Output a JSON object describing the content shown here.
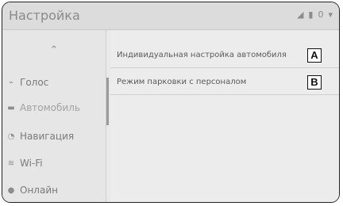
{
  "header": {
    "title": "Настройка",
    "status_icons": [
      "signal-icon",
      "battery-icon",
      "zero-icon",
      "dropdown-icon"
    ],
    "status_text": [
      "◢",
      "▮",
      "0",
      "▾"
    ]
  },
  "sidebar": {
    "up_arrow": "⌃",
    "items": [
      {
        "label": "Голос",
        "icon": "voice-icon",
        "glyph": "⌁"
      },
      {
        "label": "Автомобиль",
        "icon": "car-icon",
        "glyph": "▬"
      },
      {
        "label": "Навигация",
        "icon": "navigation-icon",
        "glyph": "◔"
      },
      {
        "label": "Wi-Fi",
        "icon": "wifi-icon",
        "glyph": "≋"
      },
      {
        "label": "Онлайн",
        "icon": "online-icon",
        "glyph": "●"
      }
    ]
  },
  "main": {
    "rows": [
      {
        "label": "Индивидуальная настройка автомобиля",
        "badge": "A"
      },
      {
        "label": "Режим парковки с персоналом",
        "badge": "B"
      }
    ]
  },
  "colors": {
    "accent": "#9a9a9a",
    "badge_border": "#111111"
  }
}
